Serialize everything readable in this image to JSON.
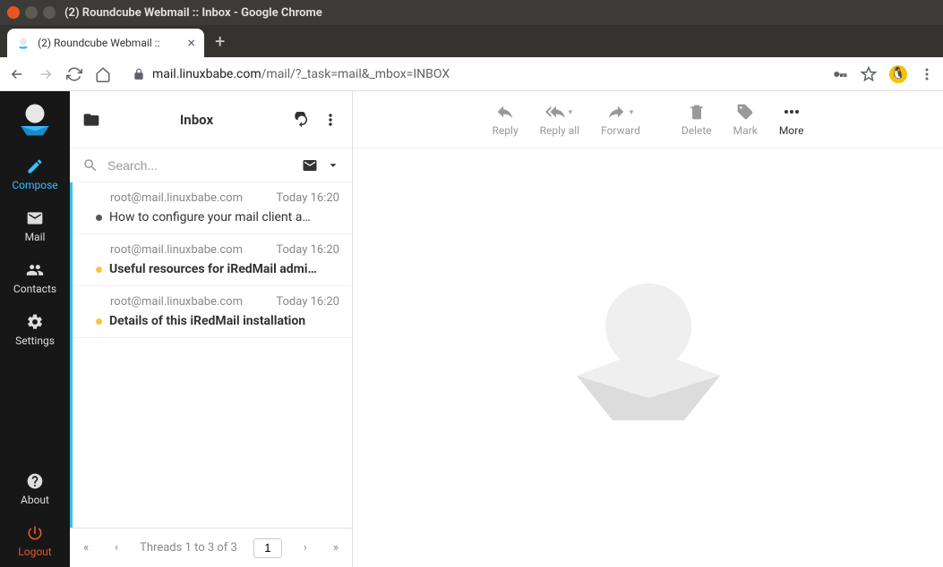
{
  "window": {
    "title": "(2) Roundcube Webmail :: Inbox - Google Chrome"
  },
  "browser": {
    "tab_title": "(2) Roundcube Webmail ::",
    "url_host": "mail.linuxbabe.com",
    "url_path": "/mail/?_task=mail&_mbox=INBOX"
  },
  "sidebar": {
    "compose": "Compose",
    "mail": "Mail",
    "contacts": "Contacts",
    "settings": "Settings",
    "about": "About",
    "logout": "Logout"
  },
  "list_header": {
    "title": "Inbox"
  },
  "search": {
    "placeholder": "Search..."
  },
  "messages": [
    {
      "from": "root@mail.linuxbabe.com",
      "date": "Today 16:20",
      "subject": "How to configure your mail client a…",
      "unread": false
    },
    {
      "from": "root@mail.linuxbabe.com",
      "date": "Today 16:20",
      "subject": "Useful resources for iRedMail admi…",
      "unread": true
    },
    {
      "from": "root@mail.linuxbabe.com",
      "date": "Today 16:20",
      "subject": "Details of this iRedMail installation",
      "unread": true
    }
  ],
  "pager": {
    "label": "Threads 1 to 3 of 3",
    "page": "1"
  },
  "toolbar": {
    "reply": "Reply",
    "reply_all": "Reply all",
    "forward": "Forward",
    "delete": "Delete",
    "mark": "Mark",
    "more": "More"
  }
}
